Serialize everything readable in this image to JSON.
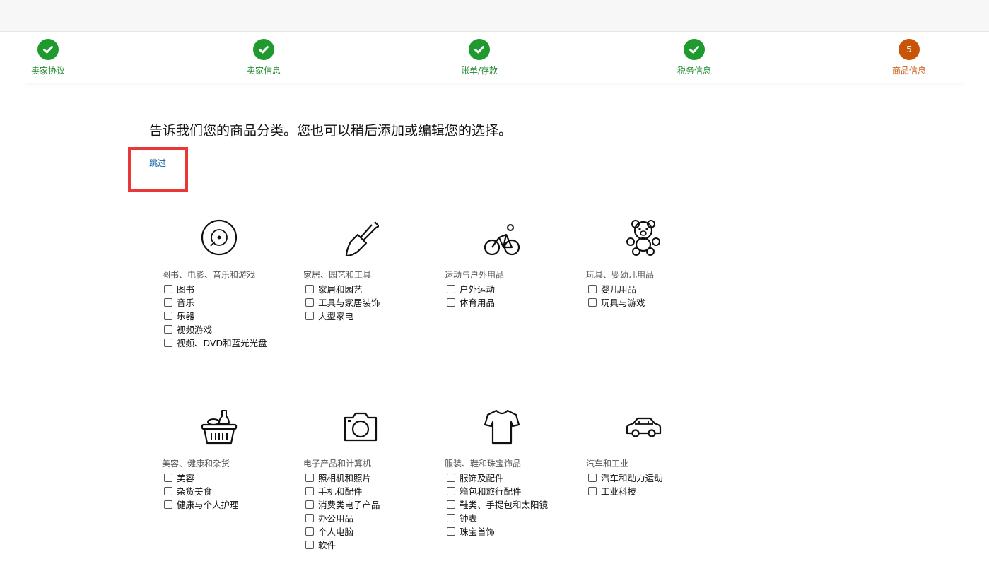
{
  "steps": [
    {
      "label": "卖家协议",
      "status": "done"
    },
    {
      "label": "卖家信息",
      "status": "done"
    },
    {
      "label": "账单/存款",
      "status": "done"
    },
    {
      "label": "税务信息",
      "status": "done"
    },
    {
      "label": "商品信息",
      "status": "current",
      "number": "5"
    }
  ],
  "heading": "告诉我们您的商品分类。您也可以稍后添加或编辑您的选择。",
  "skip_label": "跳过",
  "colors": {
    "done": "#1f9a2e",
    "current": "#c85408",
    "link": "#0b5fa5",
    "highlight": "#e93838"
  },
  "categories": [
    {
      "icon": "disc-icon",
      "title": "图书、电影、音乐和游戏",
      "items": [
        "图书",
        "音乐",
        "乐器",
        "视频游戏",
        "视频、DVD和蓝光光盘"
      ]
    },
    {
      "icon": "shovel-icon",
      "title": "家居、园艺和工具",
      "items": [
        "家居和园艺",
        "工具与家居装饰",
        "大型家电"
      ]
    },
    {
      "icon": "cyclist-icon",
      "title": "运动与户外用品",
      "items": [
        "户外运动",
        "体育用品"
      ]
    },
    {
      "icon": "teddy-bear-icon",
      "title": "玩具、婴幼儿用品",
      "items": [
        "婴儿用品",
        "玩具与游戏"
      ]
    },
    {
      "icon": "grocery-basket-icon",
      "title": "美容、健康和杂货",
      "items": [
        "美容",
        "杂货美食",
        "健康与个人护理"
      ]
    },
    {
      "icon": "camera-icon",
      "title": "电子产品和计算机",
      "items": [
        "照相机和照片",
        "手机和配件",
        "消费类电子产品",
        "办公用品",
        "个人电脑",
        "软件"
      ]
    },
    {
      "icon": "tshirt-icon",
      "title": "服装、鞋和珠宝饰品",
      "items": [
        "服饰及配件",
        "箱包和旅行配件",
        "鞋类、手提包和太阳镜",
        "钟表",
        "珠宝首饰"
      ]
    },
    {
      "icon": "car-icon",
      "title": "汽车和工业",
      "items": [
        "汽车和动力运动",
        "工业科技"
      ]
    }
  ]
}
